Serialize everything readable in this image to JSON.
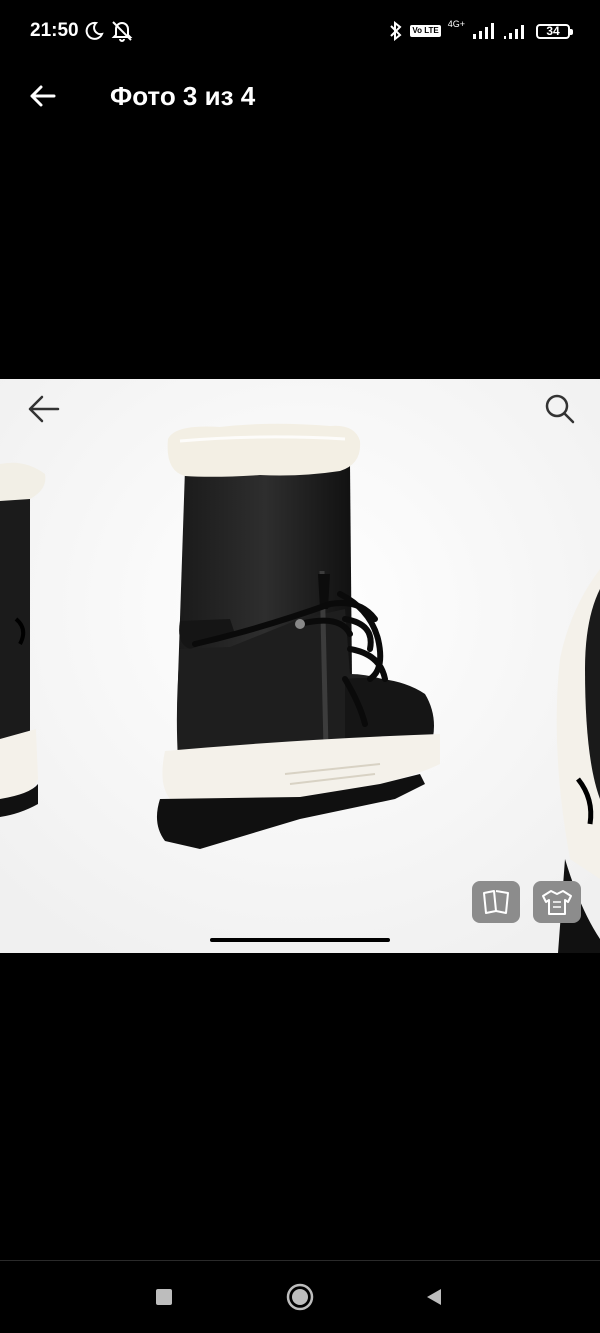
{
  "status_bar": {
    "time": "21:50",
    "left_icons": [
      "moon-icon",
      "notifications-off-icon"
    ],
    "right_icons": [
      "bluetooth-icon",
      "volte-icon",
      "signal-4g-icon",
      "signal-icon",
      "battery-icon"
    ],
    "volte_label": "Vo LTE",
    "network_label": "4G+",
    "battery_level": "34"
  },
  "header": {
    "title": "Фото 3 из 4",
    "back_icon": "arrow-left-icon"
  },
  "photo": {
    "back_icon": "arrow-left-icon",
    "search_icon": "search-icon",
    "action_buttons": [
      "catalog-book-icon",
      "shirt-outfit-icon"
    ]
  },
  "nav_bar": {
    "buttons": [
      "recent-apps-icon",
      "home-icon",
      "back-triangle-icon"
    ]
  },
  "colors": {
    "background": "#000000",
    "photo_background": "#ffffff",
    "button_gray": "#8c8c8c"
  }
}
